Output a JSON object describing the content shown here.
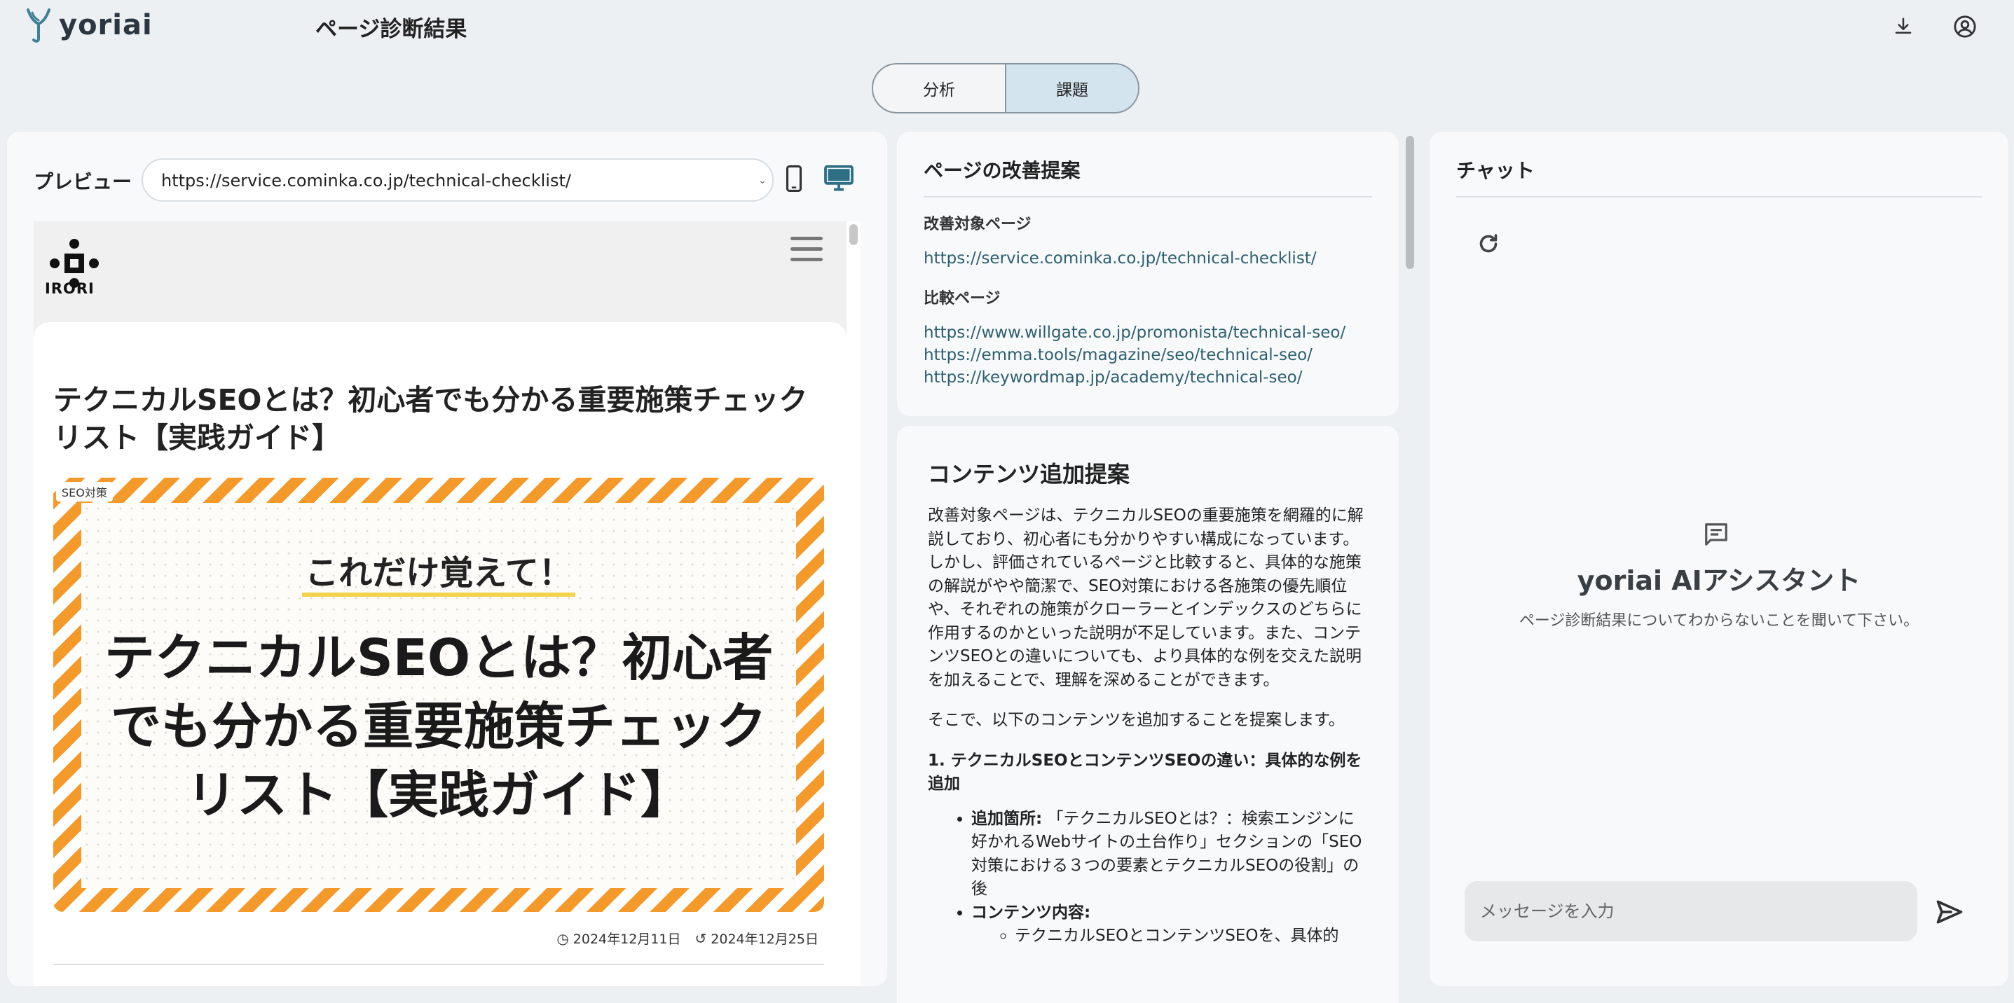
{
  "app": {
    "logo_text": "yoriai",
    "page_title": "ページ診断結果"
  },
  "header": {
    "download_icon": "download-icon",
    "account_icon": "account-circle-icon"
  },
  "tabs": [
    {
      "label": "分析",
      "active": false
    },
    {
      "label": "課題",
      "active": true
    }
  ],
  "preview": {
    "label": "プレビュー",
    "url": "https://service.cominka.co.jp/technical-checklist/",
    "device_mobile_icon": "smartphone-icon",
    "device_desktop_icon": "desktop-icon",
    "device_selected": "desktop",
    "site": {
      "logo_text": "IRORI",
      "article_title": "テクニカルSEOとは？初心者でも分かる重要施策チェックリスト【実践ガイド】",
      "hero_tag": "SEO対策",
      "hero_subtitle": "これだけ覚えて！",
      "hero_lines": [
        "テクニカルSEOとは？初心者",
        "でも分かる重要施策チェック",
        "リスト【実践ガイド】"
      ],
      "published": "2024年12月11日",
      "updated": "2024年12月25日"
    }
  },
  "suggestion": {
    "title": "ページの改善提案",
    "target_label": "改善対象ページ",
    "target_url": "https://service.cominka.co.jp/technical-checklist/",
    "compare_label": "比較ページ",
    "compare_urls": [
      "https://www.willgate.co.jp/promonista/technical-seo/",
      "https://emma.tools/magazine/seo/technical-seo/",
      "https://keywordmap.jp/academy/technical-seo/"
    ]
  },
  "content_proposal": {
    "title": "コンテンツ追加提案",
    "paragraph1": "改善対象ページは、テクニカルSEOの重要施策を網羅的に解説しており、初心者にも分かりやすい構成になっています。しかし、評価されているページと比較すると、具体的な施策の解説がやや簡潔で、SEO対策における各施策の優先順位や、それぞれの施策がクローラーとインデックスのどちらに作用するのかといった説明が不足しています。また、コンテンツSEOとの違いについても、より具体的な例を交えた説明を加えることで、理解を深めることができます。",
    "paragraph2": "そこで、以下のコンテンツを追加することを提案します。",
    "item1_heading": "1. テクニカルSEOとコンテンツSEOの違い：具体的な例を追加",
    "item1_location_label": "追加箇所:",
    "item1_location_text": "「テクニカルSEOとは？：検索エンジンに好かれるWebサイトの土台作り」セクションの「SEO対策における３つの要素とテクニカルSEOの役割」の後",
    "item1_content_label": "コンテンツ内容:",
    "item1_sub1": "テクニカルSEOとコンテンツSEOを、具体的"
  },
  "chat": {
    "title": "チャット",
    "assistant_name": "yoriai AIアシスタント",
    "assistant_hint": "ページ診断結果についてわからないことを聞いて下さい。",
    "input_placeholder": "メッセージを入力",
    "refresh_icon": "refresh-icon",
    "chat_icon": "chat-bubble-icon",
    "send_icon": "send-icon"
  },
  "colors": {
    "background": "#edf0f3",
    "panel": "#f7f9fb",
    "tab_active": "#d3e4ee",
    "link": "#2e5f6e",
    "accent_icon": "#2e6f86",
    "hero_stripe": "#f39a2a",
    "hero_underline": "#f2d34a"
  }
}
